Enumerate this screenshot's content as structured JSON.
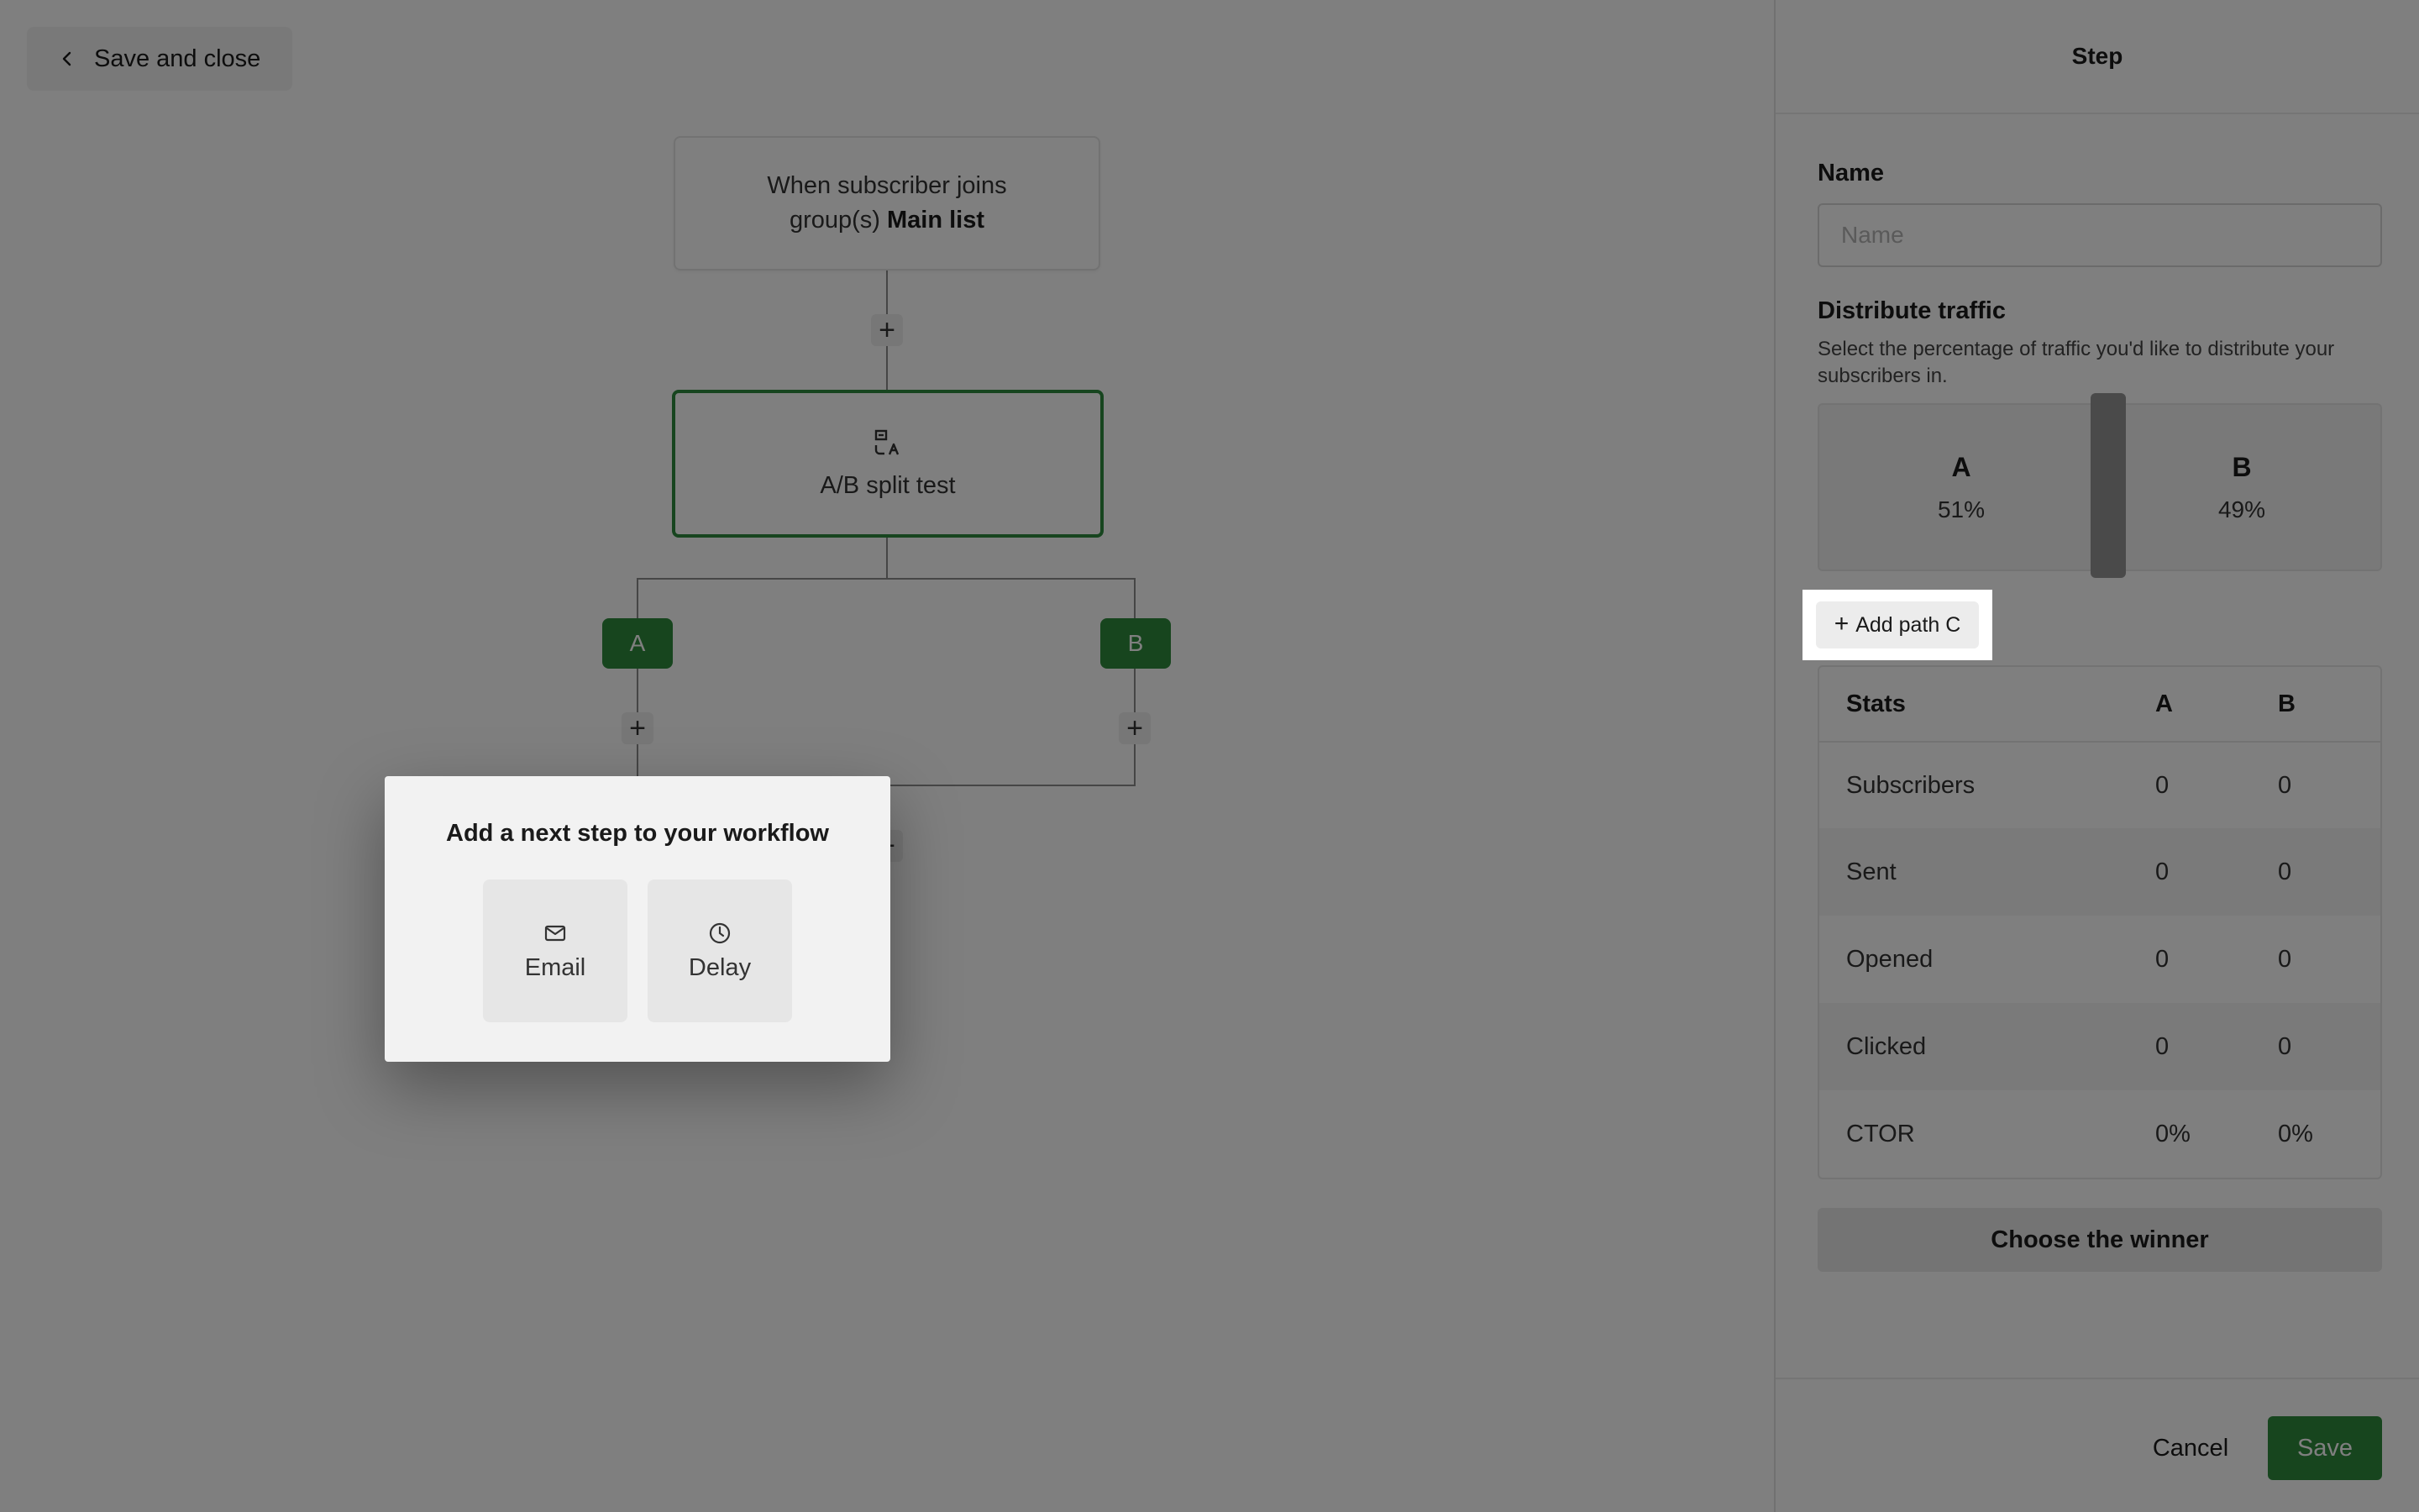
{
  "colors": {
    "accent_green": "#2f8a3d",
    "dim_overlay": "rgba(0,0,0,0.5)"
  },
  "toolbar": {
    "back_label": "Save and close",
    "back_icon": "chevron-left-icon"
  },
  "workflow": {
    "trigger_prefix": "When subscriber joins group(s) ",
    "trigger_group": "Main list",
    "split_label": "A/B split test",
    "split_icon": "ab-split-icon",
    "paths": [
      "A",
      "B"
    ],
    "add_step_glyph": "+"
  },
  "popover": {
    "title": "Add a next step to your workflow",
    "options": [
      {
        "label": "Email",
        "icon": "mail-icon"
      },
      {
        "label": "Delay",
        "icon": "clock-icon"
      }
    ]
  },
  "panel": {
    "title": "Step",
    "name_label": "Name",
    "name_placeholder": "Name",
    "name_value": "",
    "distribute_label": "Distribute traffic",
    "distribute_desc": "Select the percentage of traffic you'd like to distribute your subscribers in.",
    "traffic": [
      {
        "name": "A",
        "percent_label": "51%",
        "percent": 51
      },
      {
        "name": "B",
        "percent_label": "49%",
        "percent": 49
      }
    ],
    "add_path_label": "Add path C",
    "stats": {
      "headers": [
        "Stats",
        "A",
        "B"
      ],
      "rows": [
        [
          "Subscribers",
          "0",
          "0"
        ],
        [
          "Sent",
          "0",
          "0"
        ],
        [
          "Opened",
          "0",
          "0"
        ],
        [
          "Clicked",
          "0",
          "0"
        ],
        [
          "CTOR",
          "0%",
          "0%"
        ]
      ]
    },
    "winner_label": "Choose the winner",
    "cancel_label": "Cancel",
    "save_label": "Save"
  }
}
